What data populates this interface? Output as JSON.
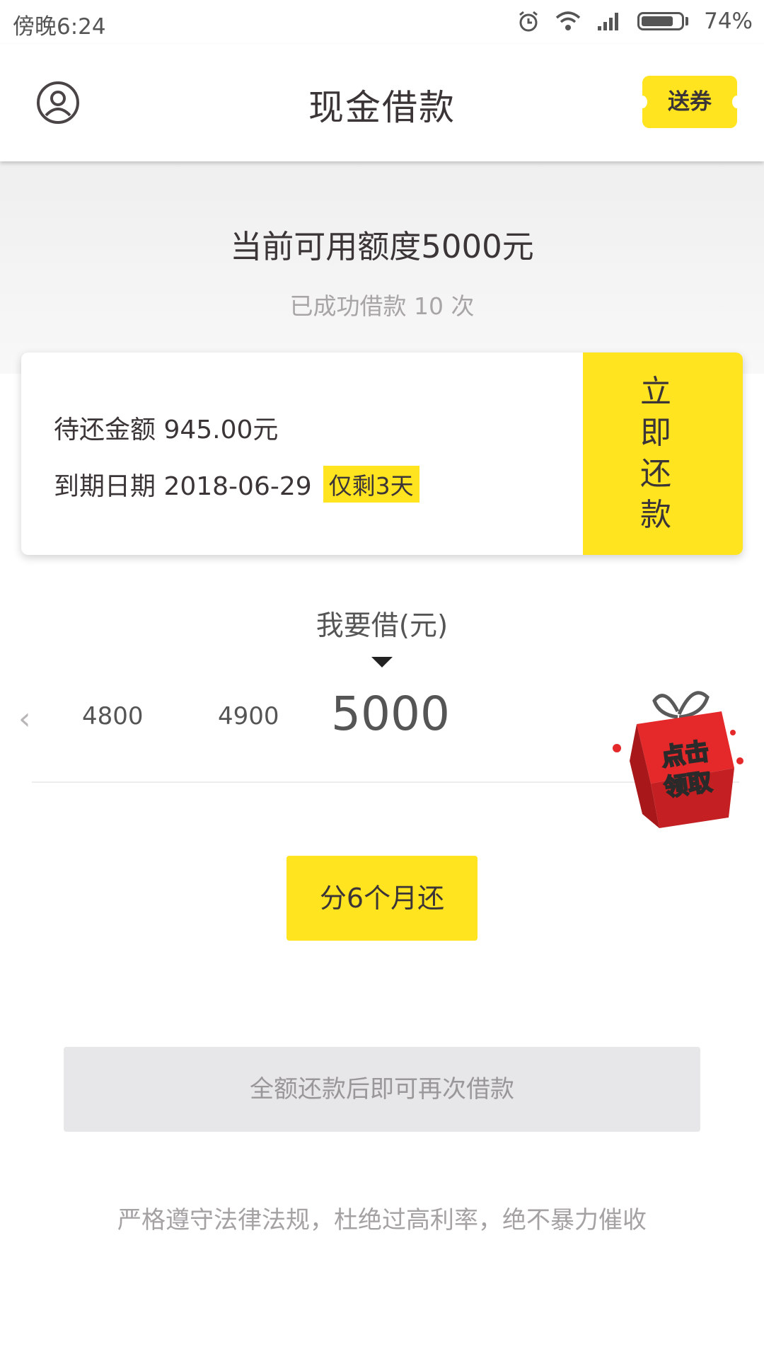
{
  "status_bar": {
    "time": "傍晚6:24",
    "battery": "74%"
  },
  "header": {
    "title": "现金借款",
    "coupon_label": "送券"
  },
  "hero": {
    "credit_line": "当前可用额度5000元",
    "borrow_count": "已成功借款 10 次"
  },
  "repayment": {
    "amount_line": "待还金额 945.00元",
    "due_line": "到期日期 2018-06-29",
    "days_left": "仅剩3天",
    "repay_now_label": "立即还款"
  },
  "borrow": {
    "label": "我要借(元)",
    "options": [
      "4800",
      "4900"
    ],
    "current": "5000"
  },
  "gift": {
    "label": "点击领取"
  },
  "installment": {
    "label": "分6个月还"
  },
  "reborrow": {
    "label": "全额还款后即可再次借款"
  },
  "footer": {
    "note": "严格遵守法律法规，杜绝过高利率，绝不暴力催收"
  },
  "colors": {
    "accent": "#ffe41f",
    "gift_red": "#e5282a"
  }
}
